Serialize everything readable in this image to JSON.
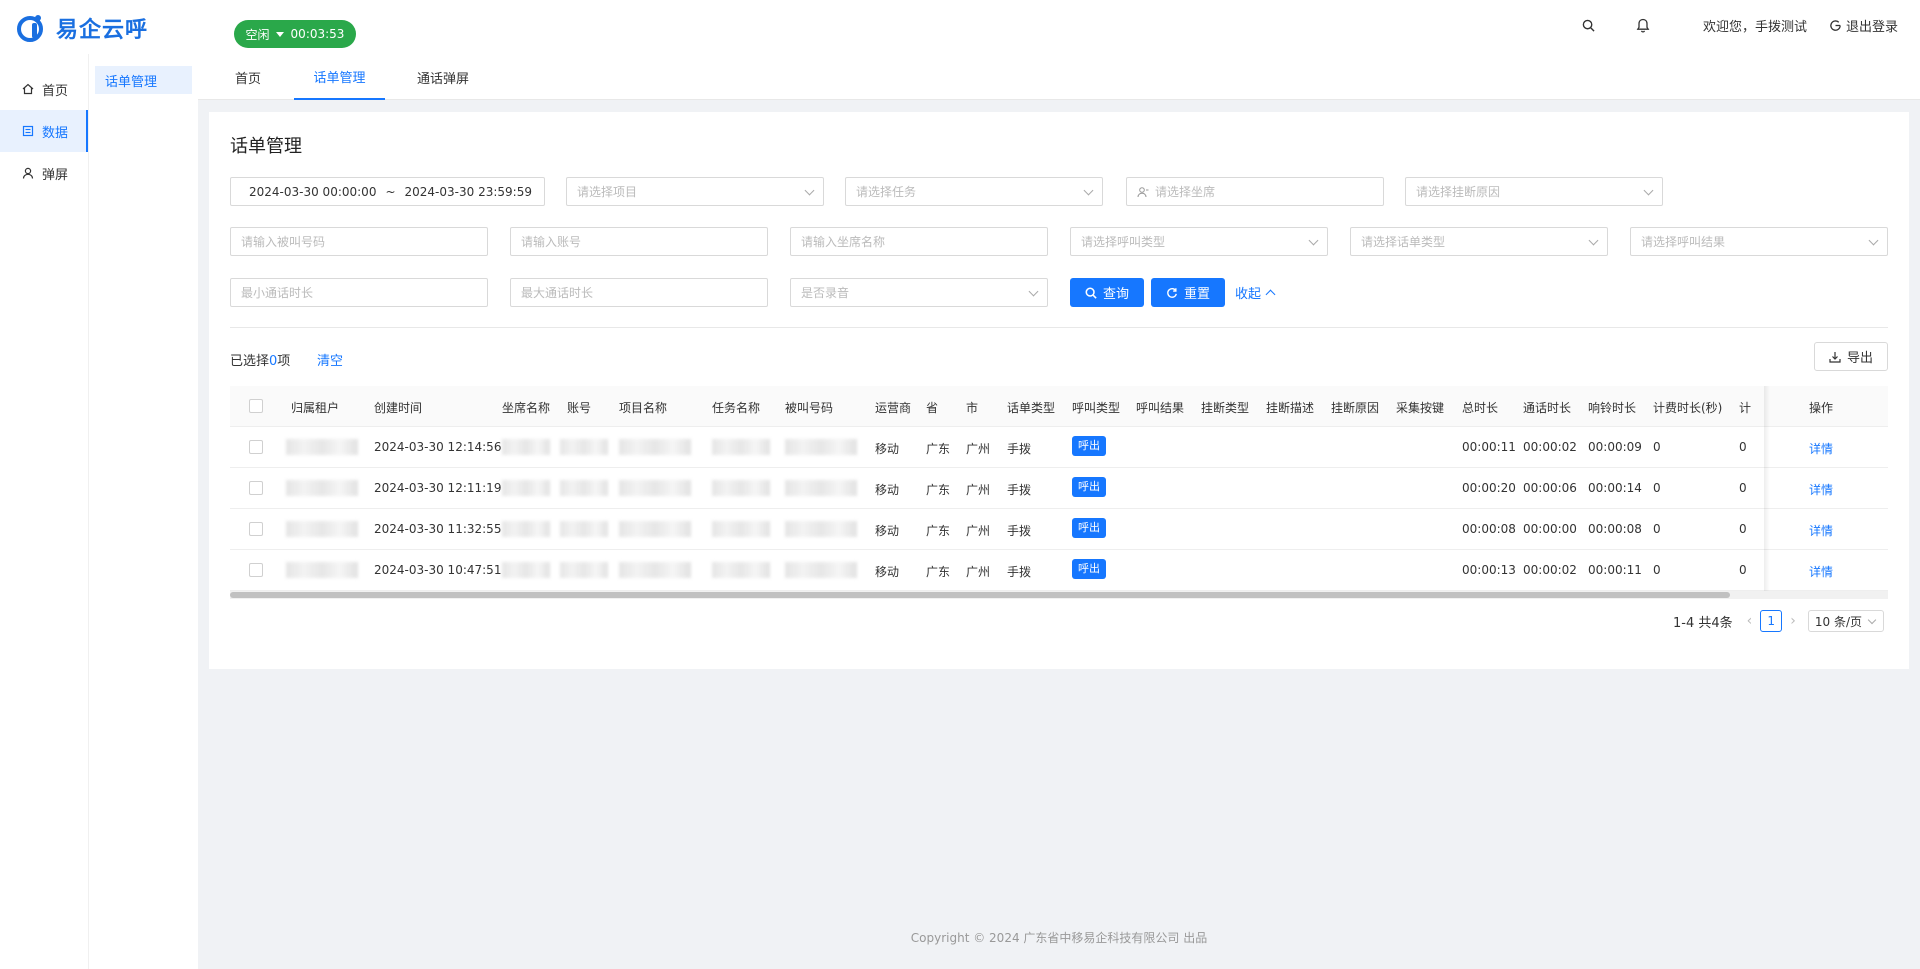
{
  "app": {
    "title": "易企云呼",
    "status": "空闲",
    "timer": "00:03:53",
    "welcome": "欢迎您，手拨测试",
    "logout": "退出登录"
  },
  "sidebar": {
    "items": [
      {
        "label": "首页",
        "icon": "home-icon"
      },
      {
        "label": "数据",
        "icon": "list-icon"
      },
      {
        "label": "弹屏",
        "icon": "user-icon"
      }
    ],
    "sub_item": "话单管理"
  },
  "tabs": [
    "首页",
    "话单管理",
    "通话弹屏"
  ],
  "page": {
    "title": "话单管理",
    "filters": {
      "date_start": "2024-03-30 00:00:00",
      "date_sep": "~",
      "date_end": "2024-03-30 23:59:59",
      "project": "请选择项目",
      "task": "请选择任务",
      "agent": "请选择坐席",
      "hangup_reason": "请选择挂断原因",
      "callee": "请输入被叫号码",
      "account": "请输入账号",
      "agent_name": "请输入坐席名称",
      "call_type": "请选择呼叫类型",
      "bill_type": "请选择话单类型",
      "call_result": "请选择呼叫结果",
      "min_duration": "最小通话时长",
      "max_duration": "最大通话时长",
      "recorded": "是否录音"
    },
    "buttons": {
      "query": "查询",
      "reset": "重置",
      "collapse": "收起",
      "export": "导出"
    },
    "selection": {
      "prefix": "已选择",
      "count": "0",
      "suffix": "项",
      "clear": "清空"
    }
  },
  "table": {
    "columns": [
      "归属租户",
      "创建时间",
      "坐席名称",
      "账号",
      "项目名称",
      "任务名称",
      "被叫号码",
      "运营商",
      "省",
      "市",
      "话单类型",
      "呼叫类型",
      "呼叫结果",
      "挂断类型",
      "挂断描述",
      "挂断原因",
      "采集按键",
      "总时长",
      "通话时长",
      "响铃时长",
      "计费时长(秒)",
      "计",
      "操作"
    ],
    "rows": [
      {
        "created": "2024-03-30 12:14:56",
        "carrier": "移动",
        "province": "广东",
        "city": "广州",
        "bill_type": "手拨",
        "call_type": "呼出",
        "total": "00:00:11",
        "talk": "00:00:02",
        "ring": "00:00:09",
        "billing": "0",
        "extra": "0",
        "action": "详情"
      },
      {
        "created": "2024-03-30 12:11:19",
        "carrier": "移动",
        "province": "广东",
        "city": "广州",
        "bill_type": "手拨",
        "call_type": "呼出",
        "total": "00:00:20",
        "talk": "00:00:06",
        "ring": "00:00:14",
        "billing": "0",
        "extra": "0",
        "action": "详情"
      },
      {
        "created": "2024-03-30 11:32:55",
        "carrier": "移动",
        "province": "广东",
        "city": "广州",
        "bill_type": "手拨",
        "call_type": "呼出",
        "total": "00:00:08",
        "talk": "00:00:00",
        "ring": "00:00:08",
        "billing": "0",
        "extra": "0",
        "action": "详情"
      },
      {
        "created": "2024-03-30 10:47:51",
        "carrier": "移动",
        "province": "广东",
        "city": "广州",
        "bill_type": "手拨",
        "call_type": "呼出",
        "total": "00:00:13",
        "talk": "00:00:02",
        "ring": "00:00:11",
        "billing": "0",
        "extra": "0",
        "action": "详情"
      }
    ]
  },
  "pagination": {
    "summary": "1-4 共4条",
    "current": "1",
    "page_size": "10 条/页"
  },
  "footer": "Copyright © 2024 广东省中移易企科技有限公司 出品",
  "colors": {
    "primary": "#1677ff",
    "status_green": "#2aa84a",
    "logo_blue": "#1a6fe0"
  }
}
